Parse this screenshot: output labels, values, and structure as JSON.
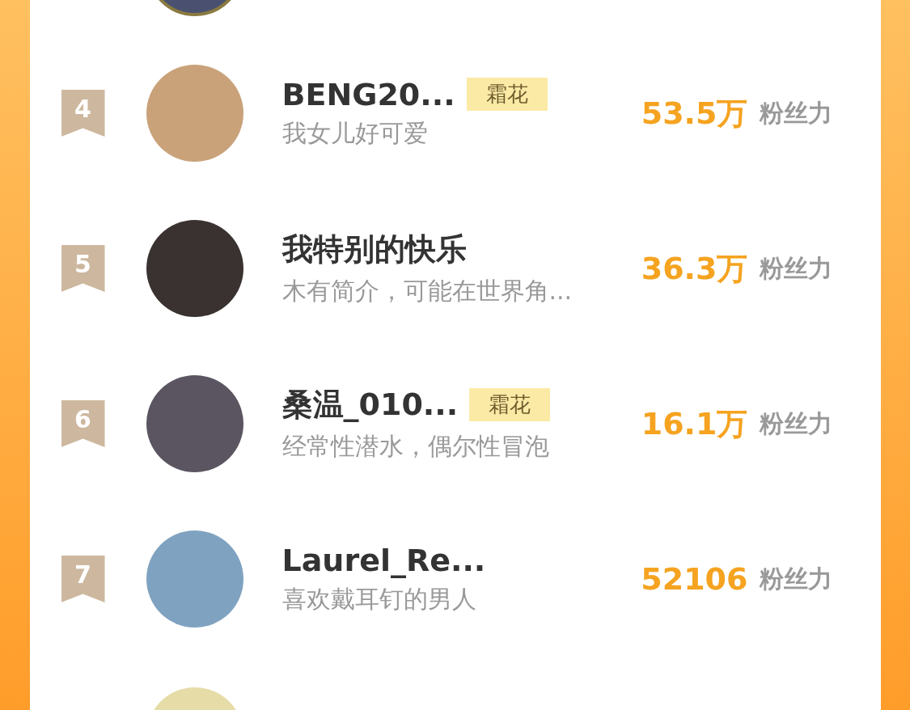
{
  "ranking": [
    {
      "rank": "4",
      "name": "BENG20...",
      "tag": "霜花",
      "bio": "我女儿好可爱",
      "value": "53.5万",
      "unit": "粉丝力"
    },
    {
      "rank": "5",
      "name": "我特别的快乐",
      "bio": "木有简介，可能在世界角...",
      "value": "36.3万",
      "unit": "粉丝力"
    },
    {
      "rank": "6",
      "name": "桑温_010...",
      "tag": "霜花",
      "bio": "经常性潜水，偶尔性冒泡",
      "value": "16.1万",
      "unit": "粉丝力"
    },
    {
      "rank": "7",
      "name": "Laurel_Re...",
      "bio": "喜欢戴耳钉的男人",
      "value": "52106",
      "unit": "粉丝力"
    }
  ]
}
